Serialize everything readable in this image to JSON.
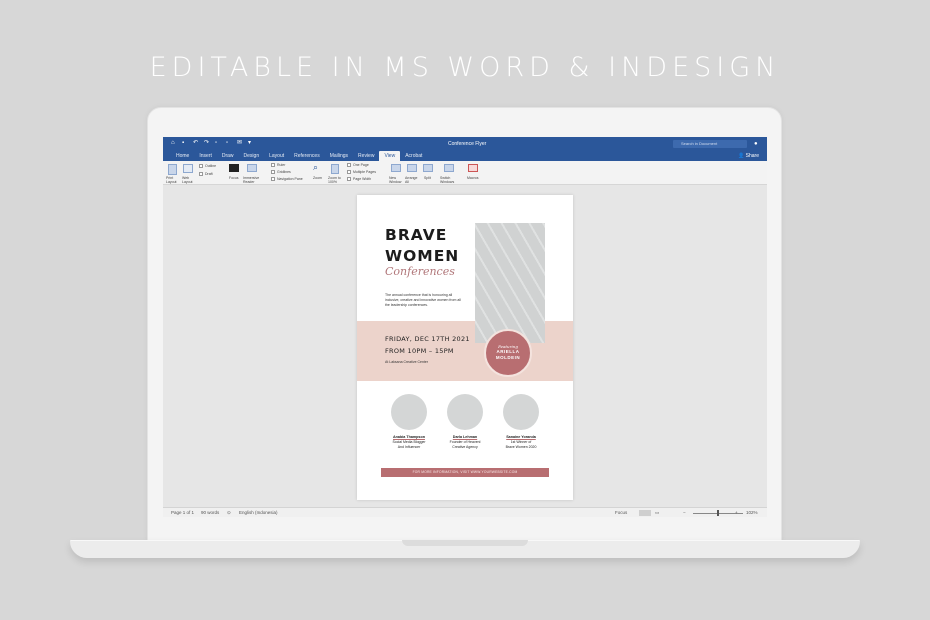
{
  "headline": "EDITABLE IN MS WORD & INDESIGN",
  "word": {
    "doc_title": "Conference Flyer",
    "search_placeholder": "Search in Document",
    "share": "Share",
    "tabs": [
      "Home",
      "Insert",
      "Draw",
      "Design",
      "Layout",
      "References",
      "Mailings",
      "Review",
      "View",
      "Acrobat"
    ],
    "active_tab": "View",
    "ribbon": {
      "print_layout": "Print Layout",
      "web_layout": "Web Layout",
      "outline": "Outline",
      "draft": "Draft",
      "focus": "Focus",
      "immersive_reader": "Immersive Reader",
      "ruler": "Ruler",
      "gridlines": "Gridlines",
      "navigation_pane": "Navigation Pane",
      "zoom": "Zoom",
      "zoom_100": "Zoom to 100%",
      "one_page": "One Page",
      "multiple_pages": "Multiple Pages",
      "page_width": "Page Width",
      "new_window": "New Window",
      "arrange_all": "Arrange All",
      "split": "Split",
      "switch_windows": "Switch Windows",
      "macros": "Macros"
    },
    "status": {
      "page": "Page 1 of 1",
      "words": "90 words",
      "language": "English (Indonesia)",
      "focus": "Focus",
      "zoom": "102%"
    }
  },
  "flyer": {
    "title_line1": "BRAVE",
    "title_line2": "WOMEN",
    "subtitle": "Conferences",
    "intro": "The annual conference that is honouring all inclusive, creative and innovative women from all the leadership conferences.",
    "date": "FRIDAY, DEC 17TH 2021",
    "time": "FROM 10PM – 15PM",
    "venue": "At Laksana Creative Center",
    "featuring_label": "Featuring",
    "speaker_name_1": "ARIELLA",
    "speaker_name_2": "MOLDEIN",
    "people": [
      {
        "name": "Anabia Thampson",
        "line1": "Social Media Blogger",
        "line2": "And Influencer"
      },
      {
        "name": "Darla Lehman",
        "line1": "Founder of Heavenl",
        "line2": "Creative Agency"
      },
      {
        "name": "Sanaine Yoranda",
        "line1": "1st Winner of",
        "line2": "Brave Women 2020"
      }
    ],
    "footer": "FOR MORE INFORMATION, VISIT WWW.YOURWEBSITE.COM"
  },
  "colors": {
    "word_blue": "#2b579a",
    "accent_rose": "#b86e71",
    "band_pink": "#ecd3cb"
  }
}
